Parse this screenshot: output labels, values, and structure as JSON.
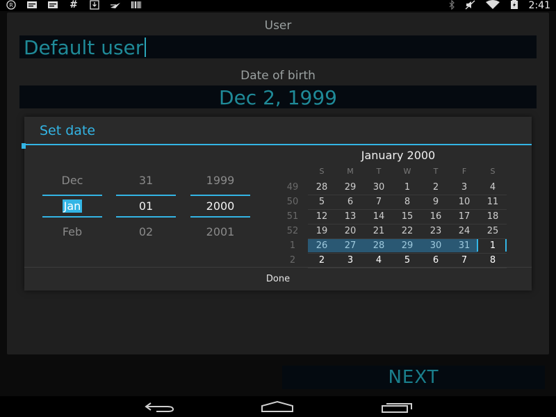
{
  "status_bar": {
    "left_icons": [
      "r-icon",
      "message-icon",
      "message-icon",
      "hash-icon",
      "download-icon",
      "plane-icon",
      "barcode-icon"
    ],
    "right_icons": [
      "bluetooth-icon",
      "mute-icon",
      "wifi-icon",
      "battery-icon"
    ],
    "time": "2:41"
  },
  "form": {
    "user_label": "User",
    "user_value": "Default user",
    "dob_label": "Date of birth",
    "dob_value": "Dec 2, 1999",
    "next_label": "NEXT"
  },
  "dialog": {
    "title": "Set date",
    "done_label": "Done",
    "spinners": {
      "month": {
        "prev": "Dec",
        "current": "Jan",
        "next": "Feb"
      },
      "day": {
        "prev": "31",
        "current": "01",
        "next": "02"
      },
      "year": {
        "prev": "1999",
        "current": "2000",
        "next": "2001"
      }
    },
    "calendar": {
      "title": "January 2000",
      "weekdays": [
        "S",
        "M",
        "T",
        "W",
        "T",
        "F",
        "S"
      ],
      "weeks": [
        {
          "num": "49",
          "days": [
            "28",
            "29",
            "30",
            "1",
            "2",
            "3",
            "4"
          ]
        },
        {
          "num": "50",
          "days": [
            "5",
            "6",
            "7",
            "8",
            "9",
            "10",
            "11"
          ]
        },
        {
          "num": "51",
          "days": [
            "12",
            "13",
            "14",
            "15",
            "16",
            "17",
            "18"
          ]
        },
        {
          "num": "52",
          "days": [
            "19",
            "20",
            "21",
            "22",
            "23",
            "24",
            "25"
          ]
        },
        {
          "num": "1",
          "days": [
            "26",
            "27",
            "28",
            "29",
            "30",
            "31",
            "1"
          ]
        },
        {
          "num": "2",
          "days": [
            "2",
            "3",
            "4",
            "5",
            "6",
            "7",
            "8"
          ]
        }
      ]
    }
  },
  "colors": {
    "accent": "#33b5e5",
    "teal_text": "#1f8a98",
    "selected_week": "#2a5873"
  }
}
